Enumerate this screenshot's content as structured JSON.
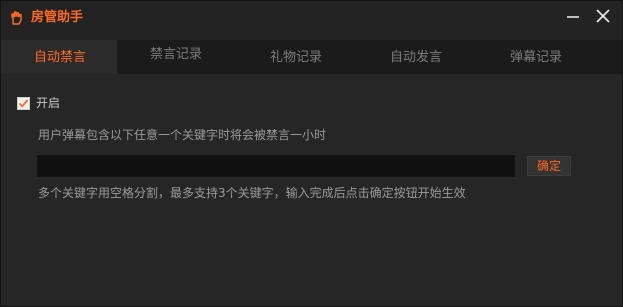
{
  "app": {
    "title": "房管助手",
    "icon": "hand-icon",
    "accent_color": "#ff6a1f"
  },
  "window_controls": {
    "minimize_icon": "minimize-icon",
    "close_icon": "close-icon"
  },
  "tabs": [
    {
      "label": "自动禁言",
      "active": true
    },
    {
      "label": "禁言记录",
      "active": false
    },
    {
      "label": "礼物记录",
      "active": false
    },
    {
      "label": "自动发言",
      "active": false
    },
    {
      "label": "弹幕记录",
      "active": false
    }
  ],
  "auto_mute": {
    "enabled": true,
    "enable_label": "开启",
    "description": "用户弹幕包含以下任意一个关键字时将会被禁言一小时",
    "keyword_input_value": "",
    "confirm_label": "确定",
    "hint": "多个关键字用空格分割，最多支持3个关键字，输入完成后点击确定按钮开始生效"
  }
}
